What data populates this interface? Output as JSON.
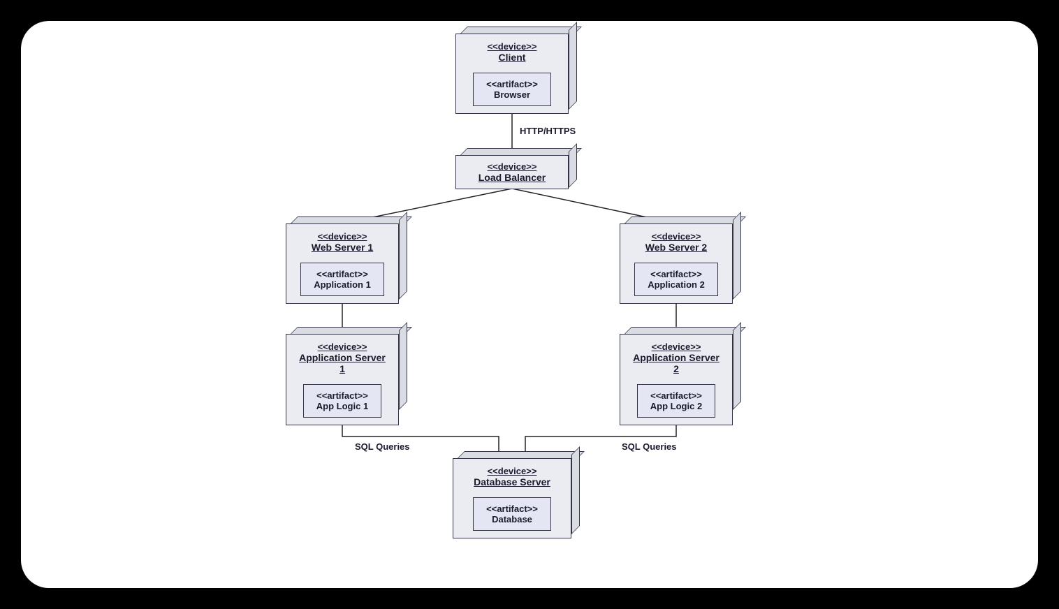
{
  "nodes": {
    "client": {
      "stereo": "<<device>>",
      "name": "Client",
      "artifact": {
        "stereo": "<<artifact>>",
        "name": "Browser"
      }
    },
    "lb": {
      "stereo": "<<device>>",
      "name": "Load Balancer"
    },
    "web1": {
      "stereo": "<<device>>",
      "name": "Web Server 1",
      "artifact": {
        "stereo": "<<artifact>>",
        "name": "Application 1"
      }
    },
    "web2": {
      "stereo": "<<device>>",
      "name": "Web Server 2",
      "artifact": {
        "stereo": "<<artifact>>",
        "name": "Application 2"
      }
    },
    "app1": {
      "stereo": "<<device>>",
      "name": "Application Server 1",
      "artifact": {
        "stereo": "<<artifact>>",
        "name": "App Logic 1"
      }
    },
    "app2": {
      "stereo": "<<device>>",
      "name": "Application Server 2",
      "artifact": {
        "stereo": "<<artifact>>",
        "name": "App Logic 2"
      }
    },
    "db": {
      "stereo": "<<device>>",
      "name": "Database Server",
      "artifact": {
        "stereo": "<<artifact>>",
        "name": "Database"
      }
    }
  },
  "edges": {
    "http": "HTTP/HTTPS",
    "sql1": "SQL Queries",
    "sql2": "SQL Queries"
  }
}
